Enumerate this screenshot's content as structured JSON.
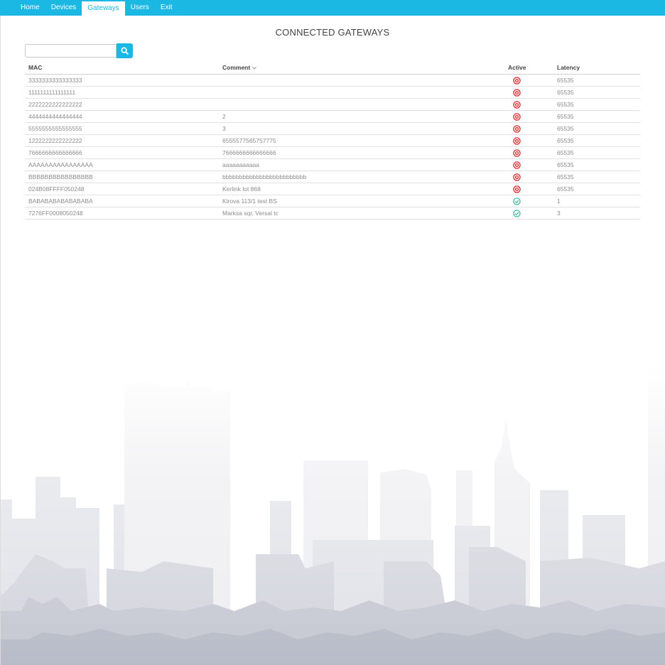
{
  "nav": {
    "items": [
      "Home",
      "Devices",
      "Gateways",
      "Users",
      "Exit"
    ],
    "active_index": 2
  },
  "page_title": "CONNECTED GATEWAYS",
  "search": {
    "placeholder": "",
    "value": "",
    "button_icon": "search-icon"
  },
  "table": {
    "headers": {
      "mac": "MAC",
      "comment": "Comment",
      "active": "Active",
      "latency": "Latency"
    },
    "sorted_by": "comment",
    "rows": [
      {
        "mac": "3333333333333333",
        "comment": "",
        "active": false,
        "latency": "65535"
      },
      {
        "mac": "1111111111111111",
        "comment": "",
        "active": false,
        "latency": "65535"
      },
      {
        "mac": "2222222222222222",
        "comment": "",
        "active": false,
        "latency": "65535"
      },
      {
        "mac": "4444444444444444",
        "comment": "2",
        "active": false,
        "latency": "65535"
      },
      {
        "mac": "5555555555555555",
        "comment": "3",
        "active": false,
        "latency": "65535"
      },
      {
        "mac": "1222222222222222",
        "comment": "6555577565757775",
        "active": false,
        "latency": "65535"
      },
      {
        "mac": "7666666666666666",
        "comment": "7666666666666666",
        "active": false,
        "latency": "65535"
      },
      {
        "mac": "AAAAAAAAAAAAAAAA",
        "comment": "aaaaaaaaaaa",
        "active": false,
        "latency": "65535"
      },
      {
        "mac": "BBBBBBBBBBBBBBBB",
        "comment": "bbbbbbbbbbbbbbbbbbbbbbbbb",
        "active": false,
        "latency": "65535"
      },
      {
        "mac": "024B08FFFF050248",
        "comment": "Kerlink lot 868",
        "active": false,
        "latency": "65535"
      },
      {
        "mac": "BABABABABABABABA",
        "comment": "Kirova 113/1 test BS",
        "active": true,
        "latency": "1"
      },
      {
        "mac": "7276FF0008050248",
        "comment": "Marksa sqr, Versal tc",
        "active": true,
        "latency": "3"
      }
    ]
  },
  "colors": {
    "accent": "#1ab8e3",
    "inactive": "#d9262c",
    "active": "#26b89a"
  }
}
